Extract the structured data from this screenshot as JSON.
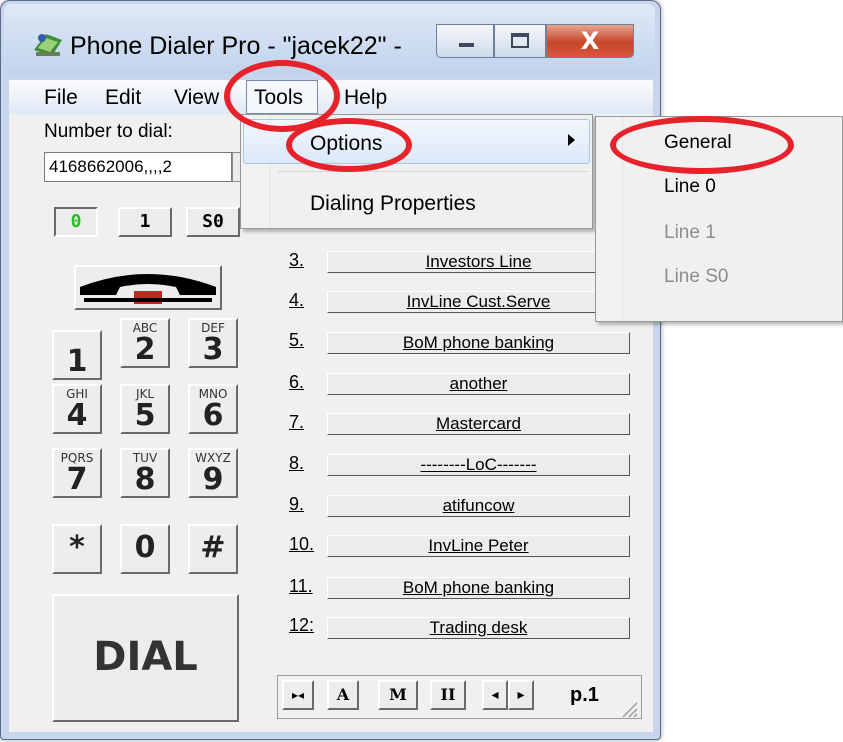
{
  "window": {
    "title": "Phone Dialer Pro - \"jacek22\" -",
    "close_symbol": "X"
  },
  "menubar": {
    "file": "File",
    "edit": "Edit",
    "view": "View",
    "tools": "Tools",
    "help": "Help"
  },
  "dialer": {
    "number_label": "Number to dial:",
    "number_value": "4168662006,,,,2",
    "line_buttons": [
      "0",
      "1",
      "S0"
    ],
    "active_line_color": "#22c022",
    "keys": [
      {
        "letters": "",
        "digit": "1"
      },
      {
        "letters": "ABC",
        "digit": "2"
      },
      {
        "letters": "DEF",
        "digit": "3"
      },
      {
        "letters": "GHI",
        "digit": "4"
      },
      {
        "letters": "JKL",
        "digit": "5"
      },
      {
        "letters": "MNO",
        "digit": "6"
      },
      {
        "letters": "PQRS",
        "digit": "7"
      },
      {
        "letters": "TUV",
        "digit": "8"
      },
      {
        "letters": "WXYZ",
        "digit": "9"
      },
      {
        "letters": "",
        "digit": "*"
      },
      {
        "letters": "",
        "digit": "0"
      },
      {
        "letters": "",
        "digit": "#"
      }
    ],
    "dial_label": "DIAL"
  },
  "speed_dial": [
    {
      "num": "3.",
      "label": "Investors Line"
    },
    {
      "num": "4.",
      "label": "InvLine Cust.Serve"
    },
    {
      "num": "5.",
      "label": "BoM phone banking"
    },
    {
      "num": "6.",
      "label": "another"
    },
    {
      "num": "7.",
      "label": "Mastercard"
    },
    {
      "num": "8.",
      "label": "--------LoC-------"
    },
    {
      "num": "9.",
      "label": "atifuncow"
    },
    {
      "num": "10.",
      "label": "InvLine Peter"
    },
    {
      "num": "11.",
      "label": "BoM phone banking"
    },
    {
      "num": "12:",
      "label": "Trading desk"
    }
  ],
  "toolbar": {
    "first": "▸◂",
    "a": "A",
    "m": "M",
    "pause": "II",
    "prev": "◂",
    "next": "▸",
    "page": "p.1"
  },
  "tools_menu": {
    "options": "Options",
    "dialing_properties": "Dialing Properties"
  },
  "options_submenu": {
    "general": "General",
    "line0": "Line 0",
    "line1": "Line 1",
    "lineS0": "Line S0"
  },
  "annotation_color": "#e8222a"
}
